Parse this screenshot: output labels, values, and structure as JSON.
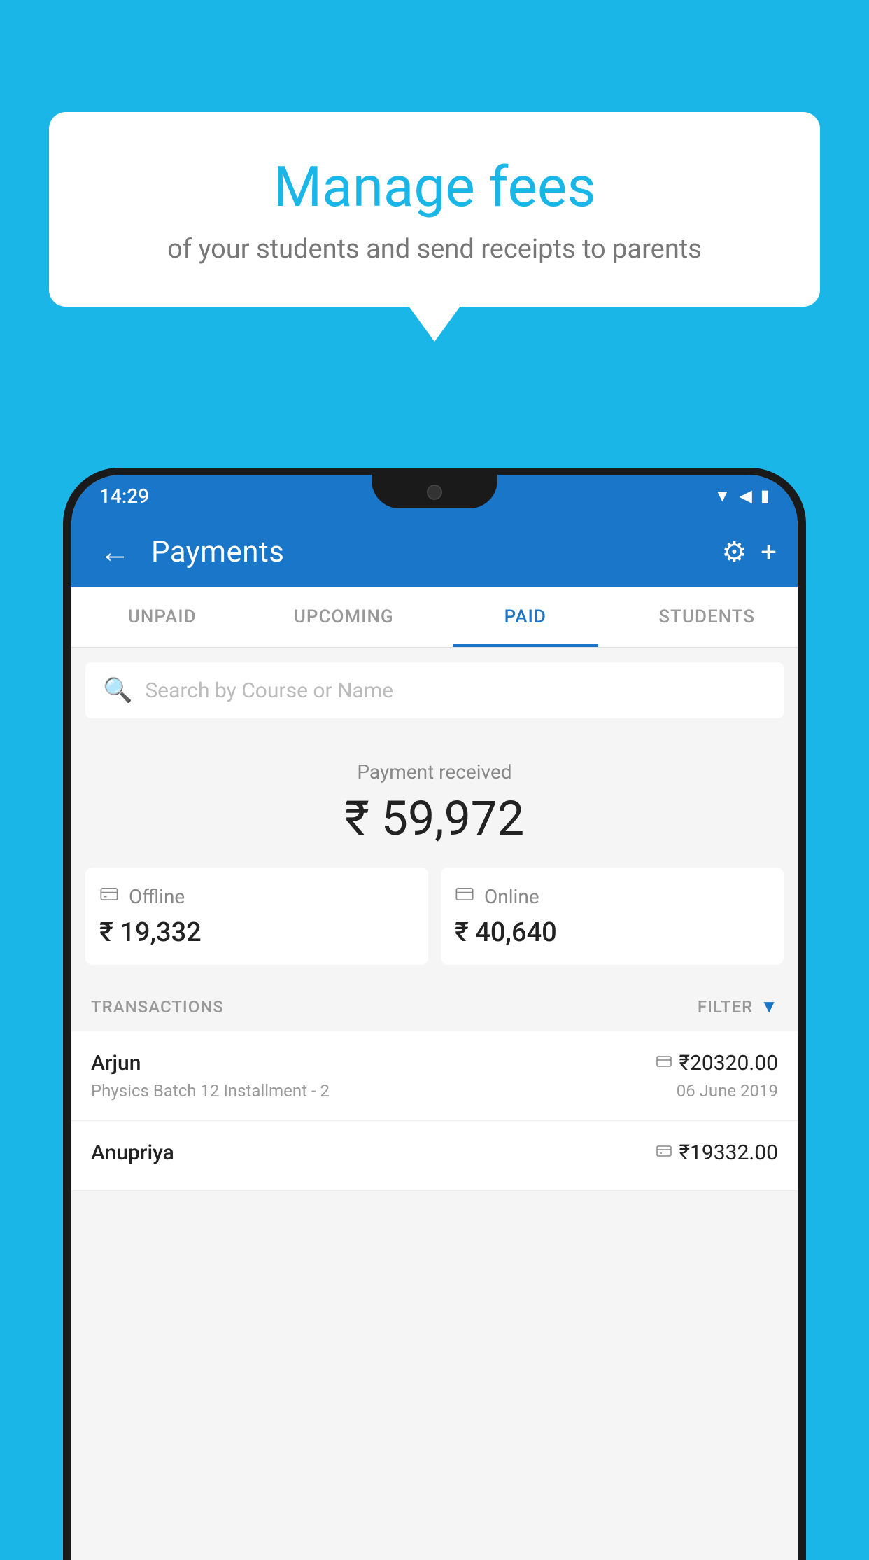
{
  "background_color": "#1ab6e8",
  "bubble": {
    "title": "Manage fees",
    "subtitle": "of your students and send receipts to parents"
  },
  "status_bar": {
    "time": "14:29",
    "wifi": "▼",
    "signal": "▲",
    "battery": "▮"
  },
  "app_bar": {
    "title": "Payments",
    "back_icon": "←",
    "gear_icon": "⚙",
    "plus_icon": "+"
  },
  "tabs": [
    {
      "label": "UNPAID",
      "active": false
    },
    {
      "label": "UPCOMING",
      "active": false
    },
    {
      "label": "PAID",
      "active": true
    },
    {
      "label": "STUDENTS",
      "active": false
    }
  ],
  "search": {
    "placeholder": "Search by Course or Name",
    "icon": "🔍"
  },
  "payment_summary": {
    "label": "Payment received",
    "amount": "₹ 59,972"
  },
  "payment_cards": [
    {
      "type": "Offline",
      "icon": "💳",
      "amount": "₹ 19,332"
    },
    {
      "type": "Online",
      "icon": "💳",
      "amount": "₹ 40,640"
    }
  ],
  "transactions_label": "TRANSACTIONS",
  "filter_label": "FILTER",
  "transactions": [
    {
      "name": "Arjun",
      "course": "Physics Batch 12 Installment - 2",
      "amount": "₹20320.00",
      "date": "06 June 2019",
      "icon": "card"
    },
    {
      "name": "Anupriya",
      "course": "",
      "amount": "₹19332.00",
      "date": "",
      "icon": "cash"
    }
  ]
}
